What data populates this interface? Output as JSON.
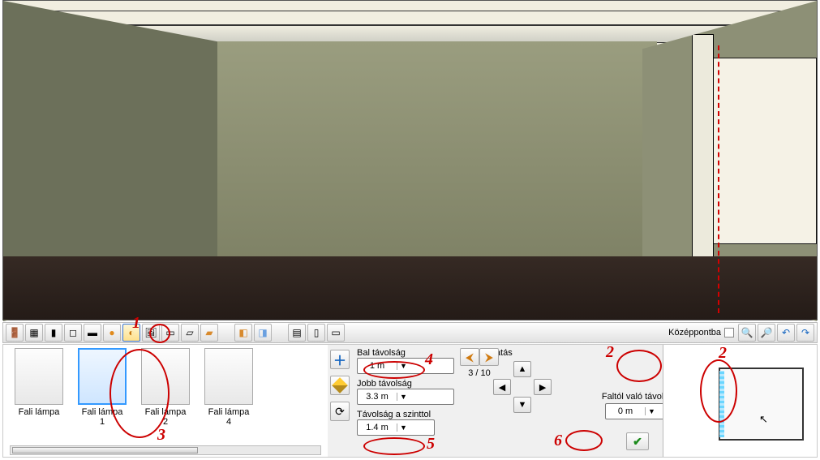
{
  "toolbar": {
    "center_label": "Középpontba",
    "icons": [
      "door-icon",
      "window-icon",
      "wall-icon",
      "switch-icon",
      "ceiling-icon",
      "ceiling-lamp-icon",
      "wall-lamp-icon",
      "picture-icon",
      "panel1-icon",
      "cornice-icon",
      "skirting-icon",
      "object1-icon",
      "object2-icon",
      "room-icon",
      "column-icon",
      "wc-icon",
      "beam-icon"
    ]
  },
  "catalog": {
    "items": [
      {
        "name": "Fali lámpa"
      },
      {
        "name": "Fali lámpa",
        "num": "1"
      },
      {
        "name": "Fali lámpa",
        "num": "2"
      },
      {
        "name": "Fali lámpa",
        "num": "4"
      }
    ]
  },
  "fields": {
    "left_label": "Bal távolság",
    "left_value": "1 m",
    "right_label": "Jobb távolság",
    "right_value": "3.3 m",
    "level_label": "Távolság a szinttol",
    "level_value": "1.4 m",
    "move_label": "Mozgatás",
    "walldist_label": "Faltól való távolság",
    "walldist_value": "0 m"
  },
  "nav": {
    "count": "3 / 10"
  },
  "annotations": [
    "1",
    "2",
    "3",
    "4",
    "5",
    "6",
    "2"
  ]
}
